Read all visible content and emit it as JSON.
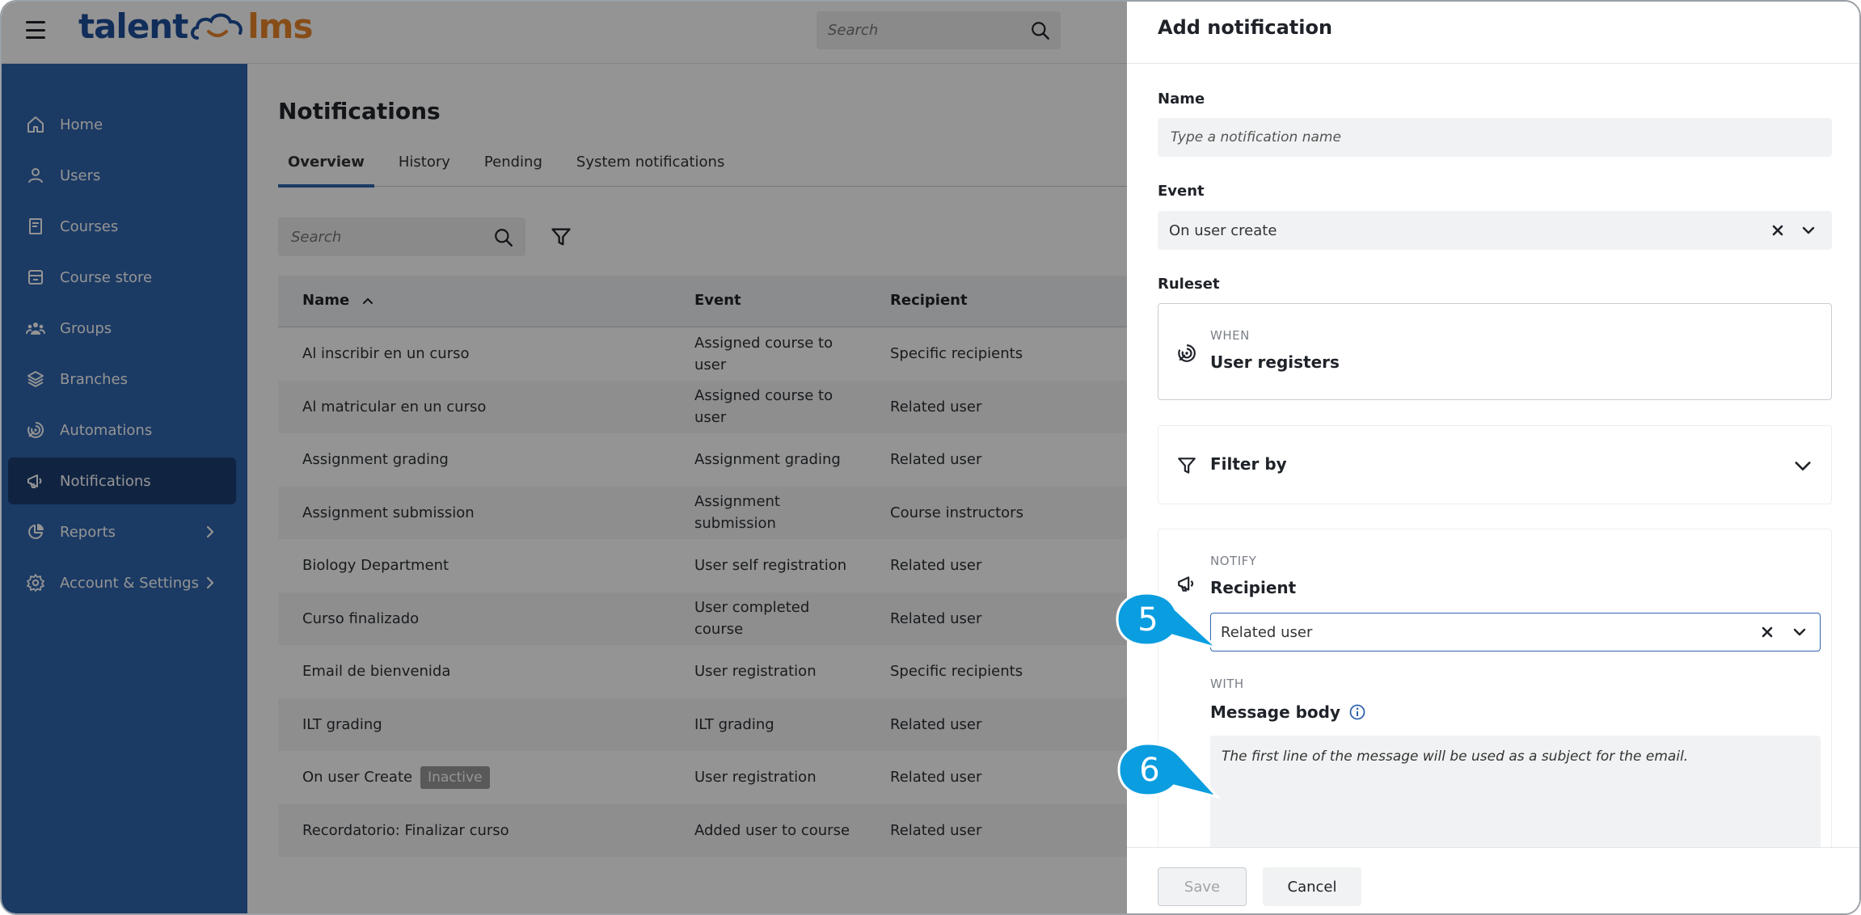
{
  "app": {
    "logo_left": "talent",
    "logo_right": "lms",
    "search_placeholder": "Search"
  },
  "sidebar": {
    "items": [
      {
        "label": "Home",
        "icon": "home-icon"
      },
      {
        "label": "Users",
        "icon": "user-icon"
      },
      {
        "label": "Courses",
        "icon": "book-icon"
      },
      {
        "label": "Course store",
        "icon": "store-icon"
      },
      {
        "label": "Groups",
        "icon": "group-icon"
      },
      {
        "label": "Branches",
        "icon": "layers-icon"
      },
      {
        "label": "Automations",
        "icon": "automation-icon"
      },
      {
        "label": "Notifications",
        "icon": "megaphone-icon",
        "active": true
      },
      {
        "label": "Reports",
        "icon": "pie-chart-icon",
        "expandable": true
      },
      {
        "label": "Account & Settings",
        "icon": "gear-icon",
        "expandable": true
      }
    ]
  },
  "page": {
    "title": "Notifications",
    "tabs": [
      "Overview",
      "History",
      "Pending",
      "System notifications"
    ],
    "active_tab": "Overview",
    "search_placeholder": "Search"
  },
  "table": {
    "columns": [
      "Name",
      "Event",
      "Recipient"
    ],
    "rows": [
      {
        "name": "Al inscribir en un curso",
        "event": "Assigned course to user",
        "recipient": "Specific recipients"
      },
      {
        "name": "Al matricular en un curso",
        "event": "Assigned course to user",
        "recipient": "Related user"
      },
      {
        "name": "Assignment grading",
        "event": "Assignment grading",
        "recipient": "Related user"
      },
      {
        "name": "Assignment submission",
        "event": "Assignment submission",
        "recipient": "Course instructors"
      },
      {
        "name": "Biology Department",
        "event": "User self registration",
        "recipient": "Related user"
      },
      {
        "name": "Curso finalizado",
        "event": "User completed course",
        "recipient": "Related user"
      },
      {
        "name": "Email de bienvenida",
        "event": "User registration",
        "recipient": "Specific recipients"
      },
      {
        "name": "ILT grading",
        "event": "ILT grading",
        "recipient": "Related user"
      },
      {
        "name": "On user Create",
        "badge": "Inactive",
        "event": "User registration",
        "recipient": "Related user"
      },
      {
        "name": "Recordatorio: Finalizar curso",
        "event": "Added user to course",
        "recipient": "Related user"
      }
    ]
  },
  "drawer": {
    "title": "Add notification",
    "name_label": "Name",
    "name_placeholder": "Type a notification name",
    "event_label": "Event",
    "event_value": "On user create",
    "ruleset_label": "Ruleset",
    "when_label": "WHEN",
    "when_value": "User registers",
    "filter_label": "Filter by",
    "notify_label": "NOTIFY",
    "recipient_label": "Recipient",
    "recipient_value": "Related user",
    "with_label": "WITH",
    "message_label": "Message body",
    "message_placeholder": "The first line of the message will be used as a subject for the email.",
    "save_label": "Save",
    "cancel_label": "Cancel"
  },
  "callouts": {
    "first": "5",
    "second": "6"
  },
  "colors": {
    "sidebar": "#2f64ad",
    "sidebar_active": "#1c3e73",
    "callout": "#0a9de0",
    "logo_blue": "#1e4f9c",
    "logo_orange": "#e8862a"
  }
}
